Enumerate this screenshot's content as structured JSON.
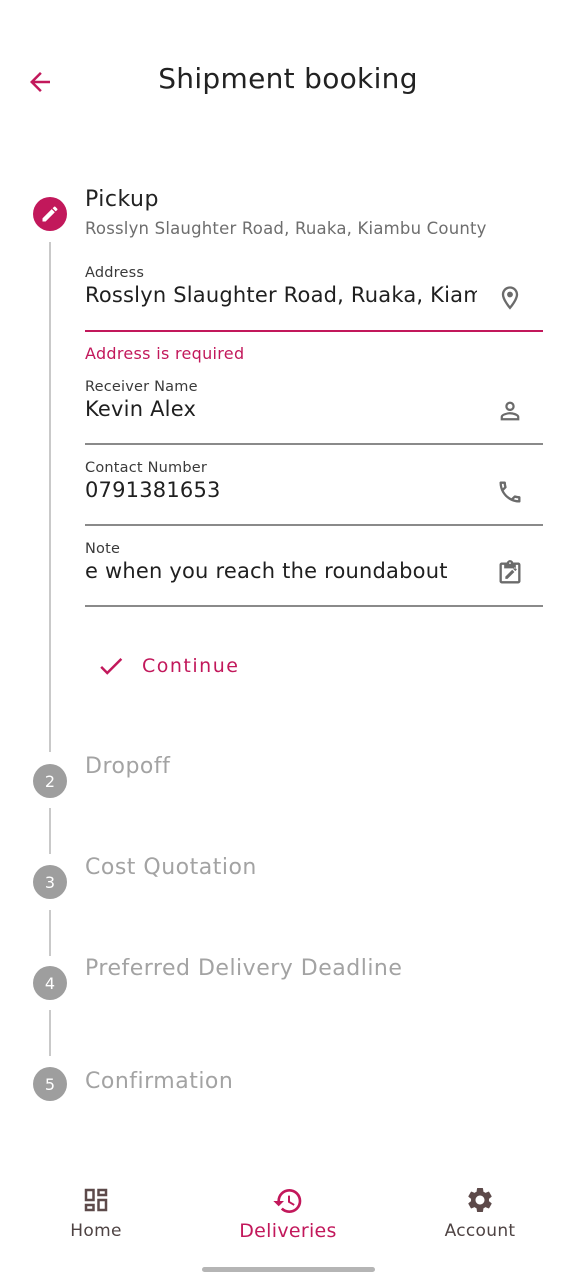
{
  "header": {
    "title": "Shipment booking"
  },
  "steps": [
    {
      "label": "Pickup",
      "subtitle": "Rosslyn Slaughter Road, Ruaka, Kiambu County"
    },
    {
      "number": "2",
      "label": "Dropoff"
    },
    {
      "number": "3",
      "label": "Cost Quotation"
    },
    {
      "number": "4",
      "label": "Preferred Delivery Deadline"
    },
    {
      "number": "5",
      "label": "Confirmation"
    }
  ],
  "form": {
    "address": {
      "label": "Address",
      "value": "Rosslyn Slaughter Road, Ruaka, Kiambu County",
      "error": "Address is required"
    },
    "receiver": {
      "label": "Receiver Name",
      "value": "Kevin Alex"
    },
    "contact": {
      "label": "Contact Number",
      "value": "0791381653"
    },
    "note": {
      "label": "Note",
      "value": "e when you reach the roundabout"
    },
    "continue_label": "Continue"
  },
  "nav": {
    "home": "Home",
    "deliveries": "Deliveries",
    "account": "Account"
  },
  "colors": {
    "accent": "#c2185b",
    "inactive_step": "#9e9e9e",
    "nav_icon": "#5d4a4a"
  }
}
